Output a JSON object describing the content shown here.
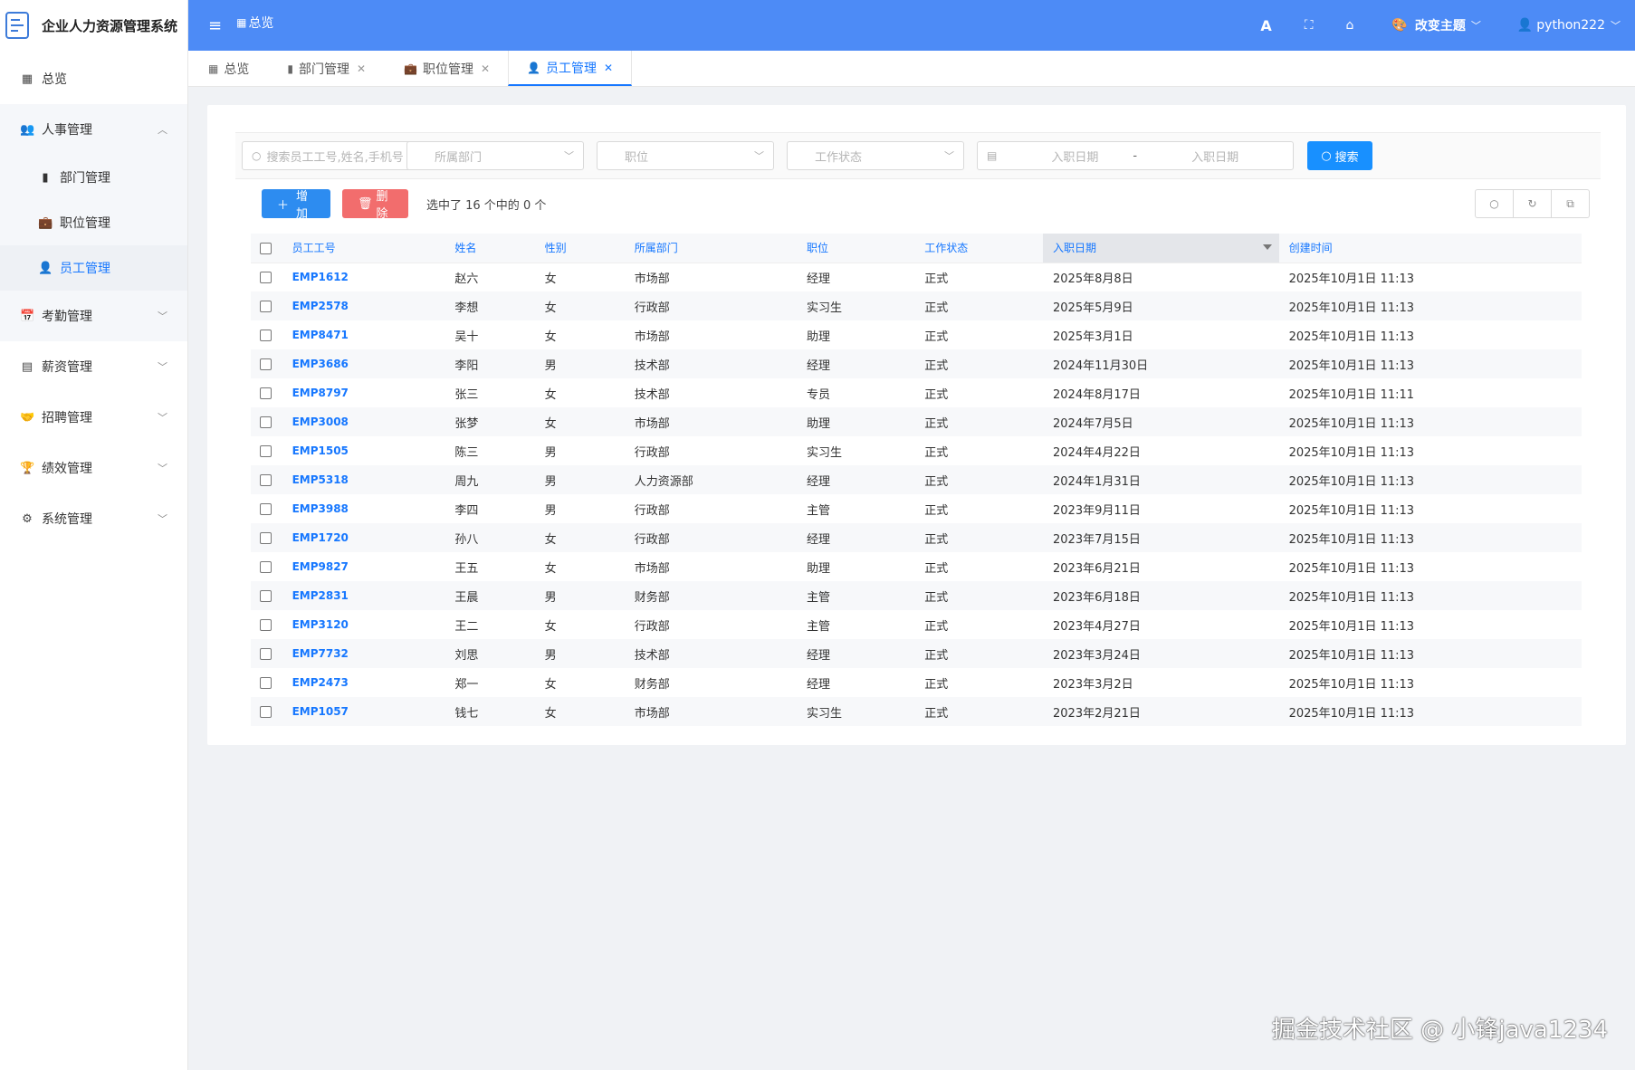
{
  "app": {
    "title": "企业人力资源管理系统"
  },
  "sidebar": {
    "items": [
      {
        "label": "总览",
        "icon": "grid-icon",
        "glyph": "▦"
      },
      {
        "label": "人事管理",
        "icon": "users-icon",
        "glyph": "👥",
        "expanded": true,
        "children": [
          {
            "label": "部门管理",
            "icon": "building-icon",
            "glyph": "▮"
          },
          {
            "label": "职位管理",
            "icon": "briefcase-icon",
            "glyph": "💼"
          },
          {
            "label": "员工管理",
            "icon": "user-icon",
            "glyph": "👤",
            "active": true
          }
        ]
      },
      {
        "label": "考勤管理",
        "icon": "calendar-icon",
        "glyph": "📅"
      },
      {
        "label": "薪资管理",
        "icon": "list-icon",
        "glyph": "▤"
      },
      {
        "label": "招聘管理",
        "icon": "handshake-icon",
        "glyph": "🤝"
      },
      {
        "label": "绩效管理",
        "icon": "trophy-icon",
        "glyph": "🏆"
      },
      {
        "label": "系统管理",
        "icon": "cogs-icon",
        "glyph": "⚙"
      }
    ]
  },
  "header": {
    "breadcrumb": "总览",
    "theme_label": "改变主题",
    "user": "python222",
    "accent": "#4d8bf6"
  },
  "tabs": [
    {
      "label": "总览",
      "icon": "grid-icon",
      "closable": false
    },
    {
      "label": "部门管理",
      "icon": "building-icon",
      "closable": true
    },
    {
      "label": "职位管理",
      "icon": "briefcase-icon",
      "closable": true
    },
    {
      "label": "员工管理",
      "icon": "user-icon",
      "closable": true,
      "active": true
    }
  ],
  "filters": {
    "search_placeholder": "搜索员工工号,姓名,手机号",
    "dept_placeholder": "所属部门",
    "position_placeholder": "职位",
    "status_placeholder": "工作状态",
    "date_start_placeholder": "入职日期",
    "date_sep": "-",
    "date_end_placeholder": "入职日期",
    "search_button": "搜索"
  },
  "toolbar": {
    "add_label": "增加",
    "delete_label": "删除",
    "selected_info": "选中了 16 个中的 0 个"
  },
  "table": {
    "columns": [
      "员工工号",
      "姓名",
      "性别",
      "所属部门",
      "职位",
      "工作状态",
      "入职日期",
      "创建时间"
    ],
    "rows": [
      [
        "EMP1612",
        "赵六",
        "女",
        "市场部",
        "经理",
        "正式",
        "2025年8月8日",
        "2025年10月1日 11:13"
      ],
      [
        "EMP2578",
        "李想",
        "女",
        "行政部",
        "实习生",
        "正式",
        "2025年5月9日",
        "2025年10月1日 11:13"
      ],
      [
        "EMP8471",
        "吴十",
        "女",
        "市场部",
        "助理",
        "正式",
        "2025年3月1日",
        "2025年10月1日 11:13"
      ],
      [
        "EMP3686",
        "李阳",
        "男",
        "技术部",
        "经理",
        "正式",
        "2024年11月30日",
        "2025年10月1日 11:13"
      ],
      [
        "EMP8797",
        "张三",
        "女",
        "技术部",
        "专员",
        "正式",
        "2024年8月17日",
        "2025年10月1日 11:11"
      ],
      [
        "EMP3008",
        "张梦",
        "女",
        "市场部",
        "助理",
        "正式",
        "2024年7月5日",
        "2025年10月1日 11:13"
      ],
      [
        "EMP1505",
        "陈三",
        "男",
        "行政部",
        "实习生",
        "正式",
        "2024年4月22日",
        "2025年10月1日 11:13"
      ],
      [
        "EMP5318",
        "周九",
        "男",
        "人力资源部",
        "经理",
        "正式",
        "2024年1月31日",
        "2025年10月1日 11:13"
      ],
      [
        "EMP3988",
        "李四",
        "男",
        "行政部",
        "主管",
        "正式",
        "2023年9月11日",
        "2025年10月1日 11:13"
      ],
      [
        "EMP1720",
        "孙八",
        "女",
        "行政部",
        "经理",
        "正式",
        "2023年7月15日",
        "2025年10月1日 11:13"
      ],
      [
        "EMP9827",
        "王五",
        "女",
        "市场部",
        "助理",
        "正式",
        "2023年6月21日",
        "2025年10月1日 11:13"
      ],
      [
        "EMP2831",
        "王晨",
        "男",
        "财务部",
        "主管",
        "正式",
        "2023年6月18日",
        "2025年10月1日 11:13"
      ],
      [
        "EMP3120",
        "王二",
        "女",
        "行政部",
        "主管",
        "正式",
        "2023年4月27日",
        "2025年10月1日 11:13"
      ],
      [
        "EMP7732",
        "刘思",
        "男",
        "技术部",
        "经理",
        "正式",
        "2023年3月24日",
        "2025年10月1日 11:13"
      ],
      [
        "EMP2473",
        "郑一",
        "女",
        "财务部",
        "经理",
        "正式",
        "2023年3月2日",
        "2025年10月1日 11:13"
      ],
      [
        "EMP1057",
        "钱七",
        "女",
        "市场部",
        "实习生",
        "正式",
        "2023年2月21日",
        "2025年10月1日 11:13"
      ]
    ]
  },
  "watermark": "掘金技术社区 @ 小锋java1234"
}
